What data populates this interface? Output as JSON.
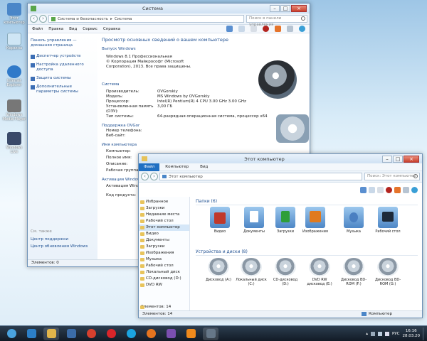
{
  "desktop": {
    "icons": [
      {
        "label": "Этот компьютер",
        "color": "#4a86c8"
      },
      {
        "label": "Корзина",
        "color": "#cfe6f5"
      },
      {
        "label": "Internet Explorer",
        "color": "#2f79c9"
      },
      {
        "label": "Windows Media Player",
        "color": "#777"
      },
      {
        "label": "Windows Live",
        "color": "#3a4a6a"
      }
    ]
  },
  "system_window": {
    "title": "Система",
    "breadcrumb": [
      "Система и безопасность",
      "Система"
    ],
    "search_placeholder": "Поиск в панели управления",
    "menu": [
      "Файл",
      "Правка",
      "Вид",
      "Сервис",
      "Справка"
    ],
    "sidebar": {
      "home": "Панель управления — домашняя страница",
      "links": [
        "Диспетчер устройств",
        "Настройка удаленного доступа",
        "Защита системы",
        "Дополнительные параметры системы"
      ],
      "see_also_title": "См. также",
      "see_also": [
        "Центр поддержки",
        "Центр обновления Windows"
      ]
    },
    "main_heading": "Просмотр основных сведений о вашем компьютере",
    "edition_section": "Выпуск Windows",
    "edition_lines": [
      "Windows 8.1 Профессиональная",
      "© Корпорация Майкрософт (Microsoft Corporation), 2013. Все права защищены."
    ],
    "system_section": "Система",
    "system_rows": [
      {
        "k": "Производитель:",
        "v": "OVGorskiy"
      },
      {
        "k": "Модель:",
        "v": "MS Windows by OVGorskiy"
      },
      {
        "k": "Процессор:",
        "v": "Intel(R) Pentium(R) 4 CPU 3.00 GHz 3.00 GHz"
      },
      {
        "k": "Установленная память (ОЗУ):",
        "v": "3,00 ГБ"
      },
      {
        "k": "Тип системы:",
        "v": "64-разрядная операционная система, процессор x64"
      }
    ],
    "support_section": "Поддержка OVGor",
    "support_rows": [
      "Номер телефона:",
      "Веб-сайт:"
    ],
    "name_section": "Имя компьютера",
    "name_rows": [
      "Компьютер:",
      "Полное имя:",
      "Описание:",
      "Рабочая группа:"
    ],
    "activation_section": "Активация Windows",
    "activation_rows": [
      "Активация Window",
      "Код продукта:"
    ],
    "status": "Элементов: 0"
  },
  "explorer_window": {
    "title": "Этот компьютер",
    "ribbon_tabs": [
      "Файл",
      "Компьютер",
      "Вид"
    ],
    "address": "Этот компьютер",
    "search_placeholder": "Поиск: Этот компьютер",
    "nav": [
      "Избранное",
      "Загрузки",
      "Недавние места",
      "Рабочий стол",
      "Этот компьютер",
      "Видео",
      "Документы",
      "Загрузки",
      "Изображения",
      "Музыка",
      "Рабочий стол",
      "Локальный диск",
      "CD-дисковод (D:)",
      "DVD RW"
    ],
    "folders_header": "Папки (6)",
    "folders": [
      {
        "label": "Видео",
        "accent": "#c0392b"
      },
      {
        "label": "Документы",
        "accent": "#5d8fc9"
      },
      {
        "label": "Загрузки",
        "accent": "#2e9e3a"
      },
      {
        "label": "Изображения",
        "accent": "#e07a1f"
      },
      {
        "label": "Музыка",
        "accent": "#4a7fc1"
      },
      {
        "label": "Рабочий стол",
        "accent": "#1d2a3a"
      }
    ],
    "devices_header": "Устройства и диски (8)",
    "drives": [
      {
        "label": "Дисковод (A:)"
      },
      {
        "label": "Локальный диск (C:)"
      },
      {
        "label": "CD-дисковод (D:)"
      },
      {
        "label": "DVD RW дисковод (E:)"
      },
      {
        "label": "Дисковод BD-ROM (F:)"
      },
      {
        "label": "Дисковод BD-ROM (G:)"
      }
    ],
    "status": "Элементов: 14",
    "status_right": "Компьютер",
    "nav_status": "Элементов: 14"
  },
  "taskbar": {
    "items": [
      {
        "name": "start",
        "color": "#4aa3df"
      },
      {
        "name": "windows8",
        "color": "#2c7fc7"
      },
      {
        "name": "explorer",
        "color": "#e2b54a"
      },
      {
        "name": "save",
        "color": "#3b6ca8"
      },
      {
        "name": "chrome",
        "color": "#d6402e"
      },
      {
        "name": "opera",
        "color": "#d8252a"
      },
      {
        "name": "skype",
        "color": "#1ba4e0"
      },
      {
        "name": "firefox",
        "color": "#e5741f"
      },
      {
        "name": "visual-studio",
        "color": "#7b4fb0"
      },
      {
        "name": "vlc",
        "color": "#f08a1c"
      },
      {
        "name": "controlpanel",
        "color": "#667788"
      }
    ],
    "lang": "РУС",
    "time": "16:16",
    "date": "28.03.20"
  }
}
